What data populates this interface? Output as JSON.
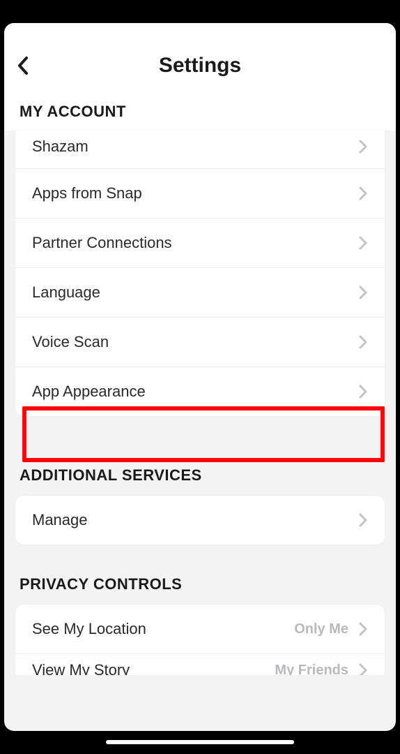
{
  "header": {
    "title": "Settings"
  },
  "sections": {
    "my_account": {
      "title": "MY ACCOUNT",
      "items": [
        {
          "label": "Shazam"
        },
        {
          "label": "Apps from Snap"
        },
        {
          "label": "Partner Connections"
        },
        {
          "label": "Language"
        },
        {
          "label": "Voice Scan"
        },
        {
          "label": "App Appearance"
        }
      ]
    },
    "additional_services": {
      "title": "ADDITIONAL SERVICES",
      "items": [
        {
          "label": "Manage"
        }
      ]
    },
    "privacy_controls": {
      "title": "PRIVACY CONTROLS",
      "items": [
        {
          "label": "See My Location",
          "value": "Only Me"
        },
        {
          "label": "View My Story",
          "value": "My Friends"
        }
      ]
    }
  }
}
